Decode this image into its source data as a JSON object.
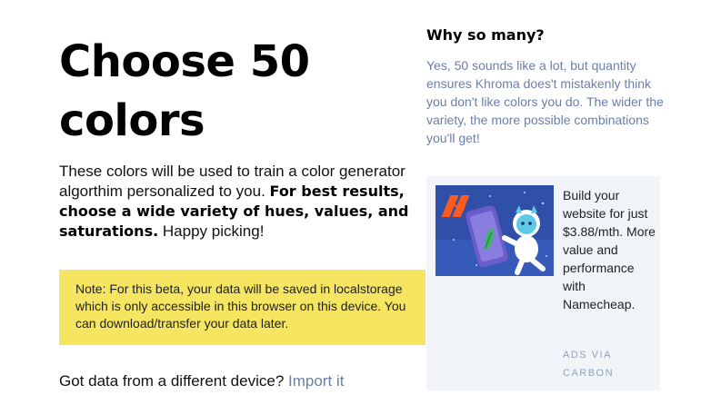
{
  "main": {
    "title": "Choose 50 colors",
    "intro_text": "These colors will be used to train a color generator algorthim personalized to you.",
    "intro_bold": "For best results, choose a wide variety of hues, values, and saturations.",
    "intro_tail": "Happy picking!",
    "note": "Note: For this beta, your data will be saved in localstorage which is only accessible in this browser on this device. You can download/transfer your data later.",
    "import_prompt": "Got data from a different device?",
    "import_link": "Import it"
  },
  "sidebar": {
    "why_title": "Why so many?",
    "why_body": "Yes, 50 sounds like a lot, but quantity ensures Khroma does't mistakenly think you don't like colors you do. The wider the variety, the more possible combinations you'll get!"
  },
  "ad": {
    "text": "Build your website for just $3.88/mth. More value and performance with Namecheap.",
    "via": "ADS VIA CARBON",
    "colors": {
      "image_bg": "#2f4fa8",
      "logo": "#ff5a1f",
      "phone": "#6a5cc9",
      "leaf": "#44b36a",
      "astronaut": "#ffffff",
      "mascot": "#5ec8e8"
    }
  },
  "colors": {
    "accent_link": "#6b7fa8",
    "note_bg": "#f5e560",
    "ad_bg": "#f1f5fa"
  }
}
